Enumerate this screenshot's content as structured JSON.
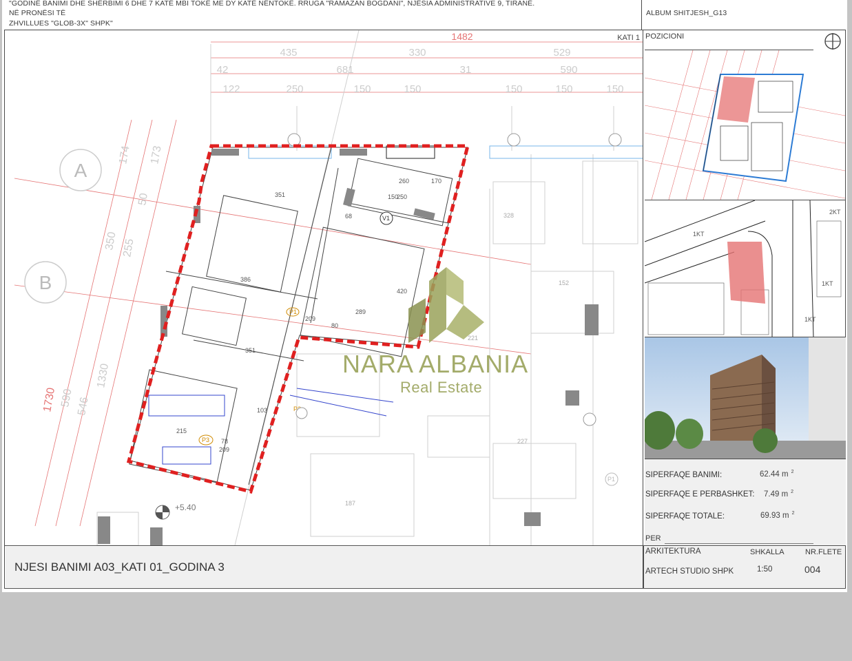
{
  "header": {
    "line1": "\"GODINË BANIMI DHE SHËRBIMI 6 DHE 7 KATË MBI TOKË ME DY KATË NËNTOKË. RRUGA \"RAMAZAN BOGDANI\", NJËSIA ADMINISTRATIVE 9, TIRANË.",
    "line2": "NË PRONËSI TË",
    "line3": "ZHVILLUES \"GLOB-3X\" SHPK\"",
    "album": "ALBUM SHITJESH_G13"
  },
  "plan": {
    "floor_label": "KATI 1",
    "axis_labels": [
      "A",
      "B"
    ],
    "top_dims_row1": [
      "1482"
    ],
    "top_dims_row2": [
      "435",
      "330",
      "529"
    ],
    "top_dims_row3": [
      "42",
      "681",
      "31",
      "590"
    ],
    "top_dims_row4": [
      "122",
      "250",
      "150",
      "150",
      "150",
      "150",
      "150"
    ],
    "left_dims": [
      "174",
      "173",
      "50",
      "350",
      "255",
      "1730",
      "590",
      "546",
      "1330"
    ],
    "room_dims": [
      "351",
      "386",
      "351",
      "260",
      "170",
      "150",
      "250",
      "420",
      "289",
      "103",
      "68",
      "215",
      "78",
      "209",
      "80",
      "209"
    ],
    "room_tags": [
      "P1",
      "P2",
      "P3",
      "V1"
    ],
    "level_mark": "+5.40",
    "other_dims": [
      "328",
      "187",
      "152",
      "227",
      "221"
    ],
    "right_tags": [
      "P1"
    ]
  },
  "position": {
    "title": "POZICIONI",
    "site_labels": [
      "2KT",
      "1KT",
      "1KT",
      "1KT"
    ]
  },
  "areas": [
    {
      "label": "SIPERFAQE BANIMI:",
      "value": "62.44 m",
      "unit_sup": "2"
    },
    {
      "label": "SIPERFAQE E PERBASHKET:",
      "value": "7.49 m",
      "unit_sup": "2"
    },
    {
      "label": "SIPERFAQE TOTALE:",
      "value": "69.93 m",
      "unit_sup": "2"
    }
  ],
  "per_label": "PER",
  "footer": {
    "unit_title": "NJESI BANIMI A03_KATI 01_GODINA 3",
    "arch_label": "ARKITEKTURA",
    "scale_label": "SHKALLA",
    "sheet_label": "NR.FLETE",
    "arch_value": "ARTECH STUDIO SHPK",
    "scale_value": "1:50",
    "sheet_value": "004"
  },
  "watermark": {
    "line1": "NARA ALBANIA",
    "line2": "Real Estate"
  },
  "colors": {
    "page_bg": "#c4c4c4",
    "sheet_bg": "#ffffff",
    "border": "#4a4a4a",
    "dims_red": "#e57373",
    "unit_outline": "#e02020",
    "watermark": "#9aa25a",
    "plan_lines": "#444444",
    "blue_lines": "#3344cc"
  },
  "icons": [
    "north-arrow-icon",
    "section-marker-icon"
  ]
}
